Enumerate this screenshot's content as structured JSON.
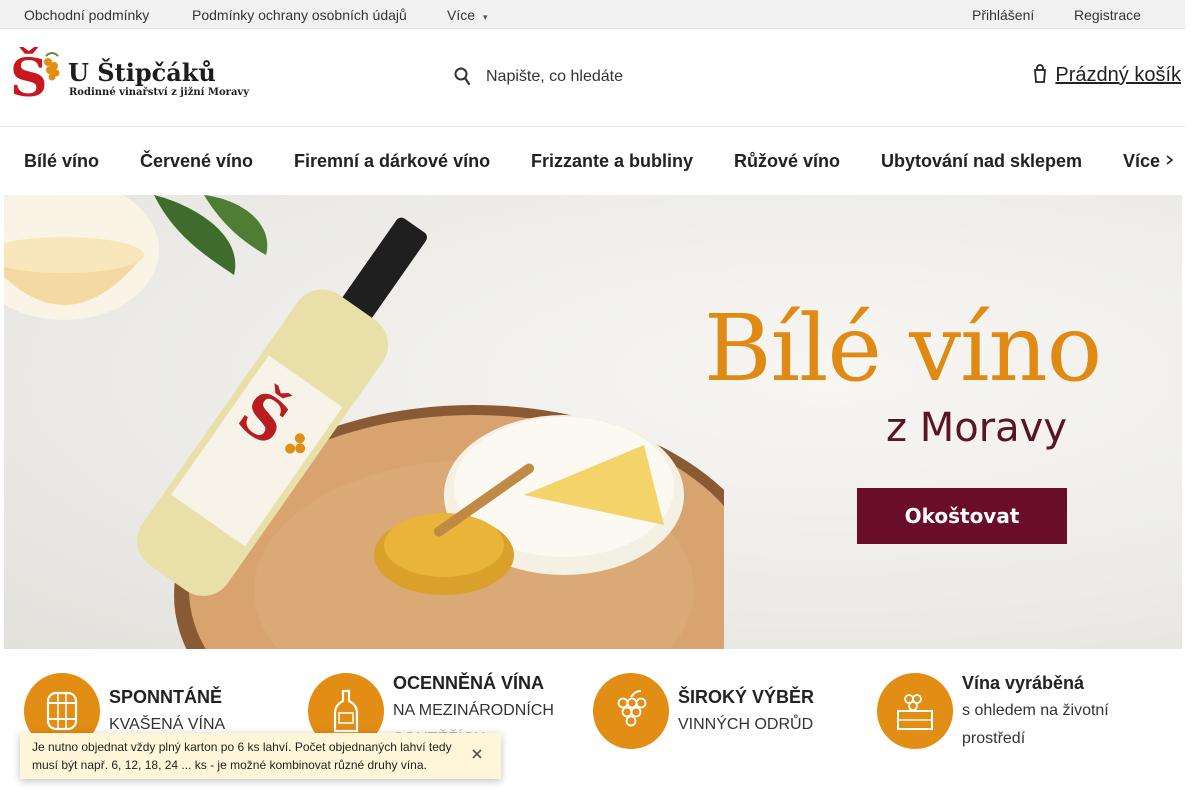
{
  "topbar": {
    "links": [
      "Obchodní podmínky",
      "Podmínky ochrany osobních údajů"
    ],
    "more_label": "Více",
    "login_label": "Přihlášení",
    "register_label": "Registrace"
  },
  "header": {
    "logo_title": "U Štipčáků",
    "logo_subtitle": "Rodinné vinařství z jižní Moravy",
    "search_placeholder": "Napište, co hledáte",
    "cart_label": "Prázdný košík"
  },
  "nav": {
    "items": [
      "Bílé víno",
      "Červené víno",
      "Firemní a dárkové víno",
      "Frizzante a bubliny",
      "Růžové víno",
      "Ubytování nad sklepem"
    ],
    "more_label": "Více"
  },
  "hero": {
    "title": "Bílé víno",
    "subtitle": "z Moravy",
    "cta_label": "Okoštovat"
  },
  "features": [
    {
      "title": "SPONNTÁNĚ",
      "lines": [
        "KVAŠENÁ VÍNA"
      ],
      "icon": "barrel-icon"
    },
    {
      "title": "OCENNĚNÁ VÍNA",
      "lines": [
        "NA MEZINÁRODNÍCH",
        "SOUTĚŽÍCH"
      ],
      "icon": "bottle-icon"
    },
    {
      "title": "ŠIROKÝ VÝBĚR",
      "lines": [
        "VINNÝCH ODRŮD"
      ],
      "icon": "grapes-icon"
    },
    {
      "title": "Vína vyráběná",
      "lines": [
        "s ohledem na životní",
        "prostředí"
      ],
      "icon": "crate-icon"
    }
  ],
  "notice": {
    "text": "Je nutno objednat vždy plný karton po 6 ks lahví. Počet objednaných lahví tedy musí být např. 6, 12, 18, 24 ... ks - je možné kombinovat různé druhy vína."
  },
  "colors": {
    "accent": "#e28d14",
    "cta": "#6a0d29",
    "notice_bg": "#fff6d9"
  }
}
